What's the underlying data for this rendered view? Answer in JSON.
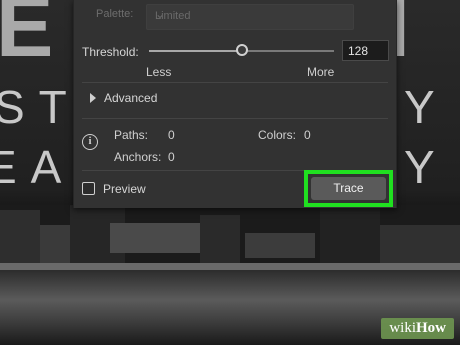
{
  "dialog": {
    "palette_label": "Palette:",
    "palette_value": "Limited",
    "threshold_label": "Threshold:",
    "threshold_value": "128",
    "threshold_fraction": 0.5,
    "less_label": "Less",
    "more_label": "More",
    "advanced_label": "Advanced",
    "paths_label": "Paths:",
    "paths_value": "0",
    "colors_label": "Colors:",
    "colors_value": "0",
    "anchors_label": "Anchors:",
    "anchors_value": "0",
    "preview_label": "Preview",
    "preview_checked": false,
    "trace_label": "Trace"
  },
  "highlight_color": "#20e020",
  "background": {
    "row1_left": "ST",
    "row1_right": "Y",
    "row2_left": "EAS",
    "row2_right": "Y"
  },
  "watermark": {
    "part1": "wiki",
    "part2": "How"
  }
}
